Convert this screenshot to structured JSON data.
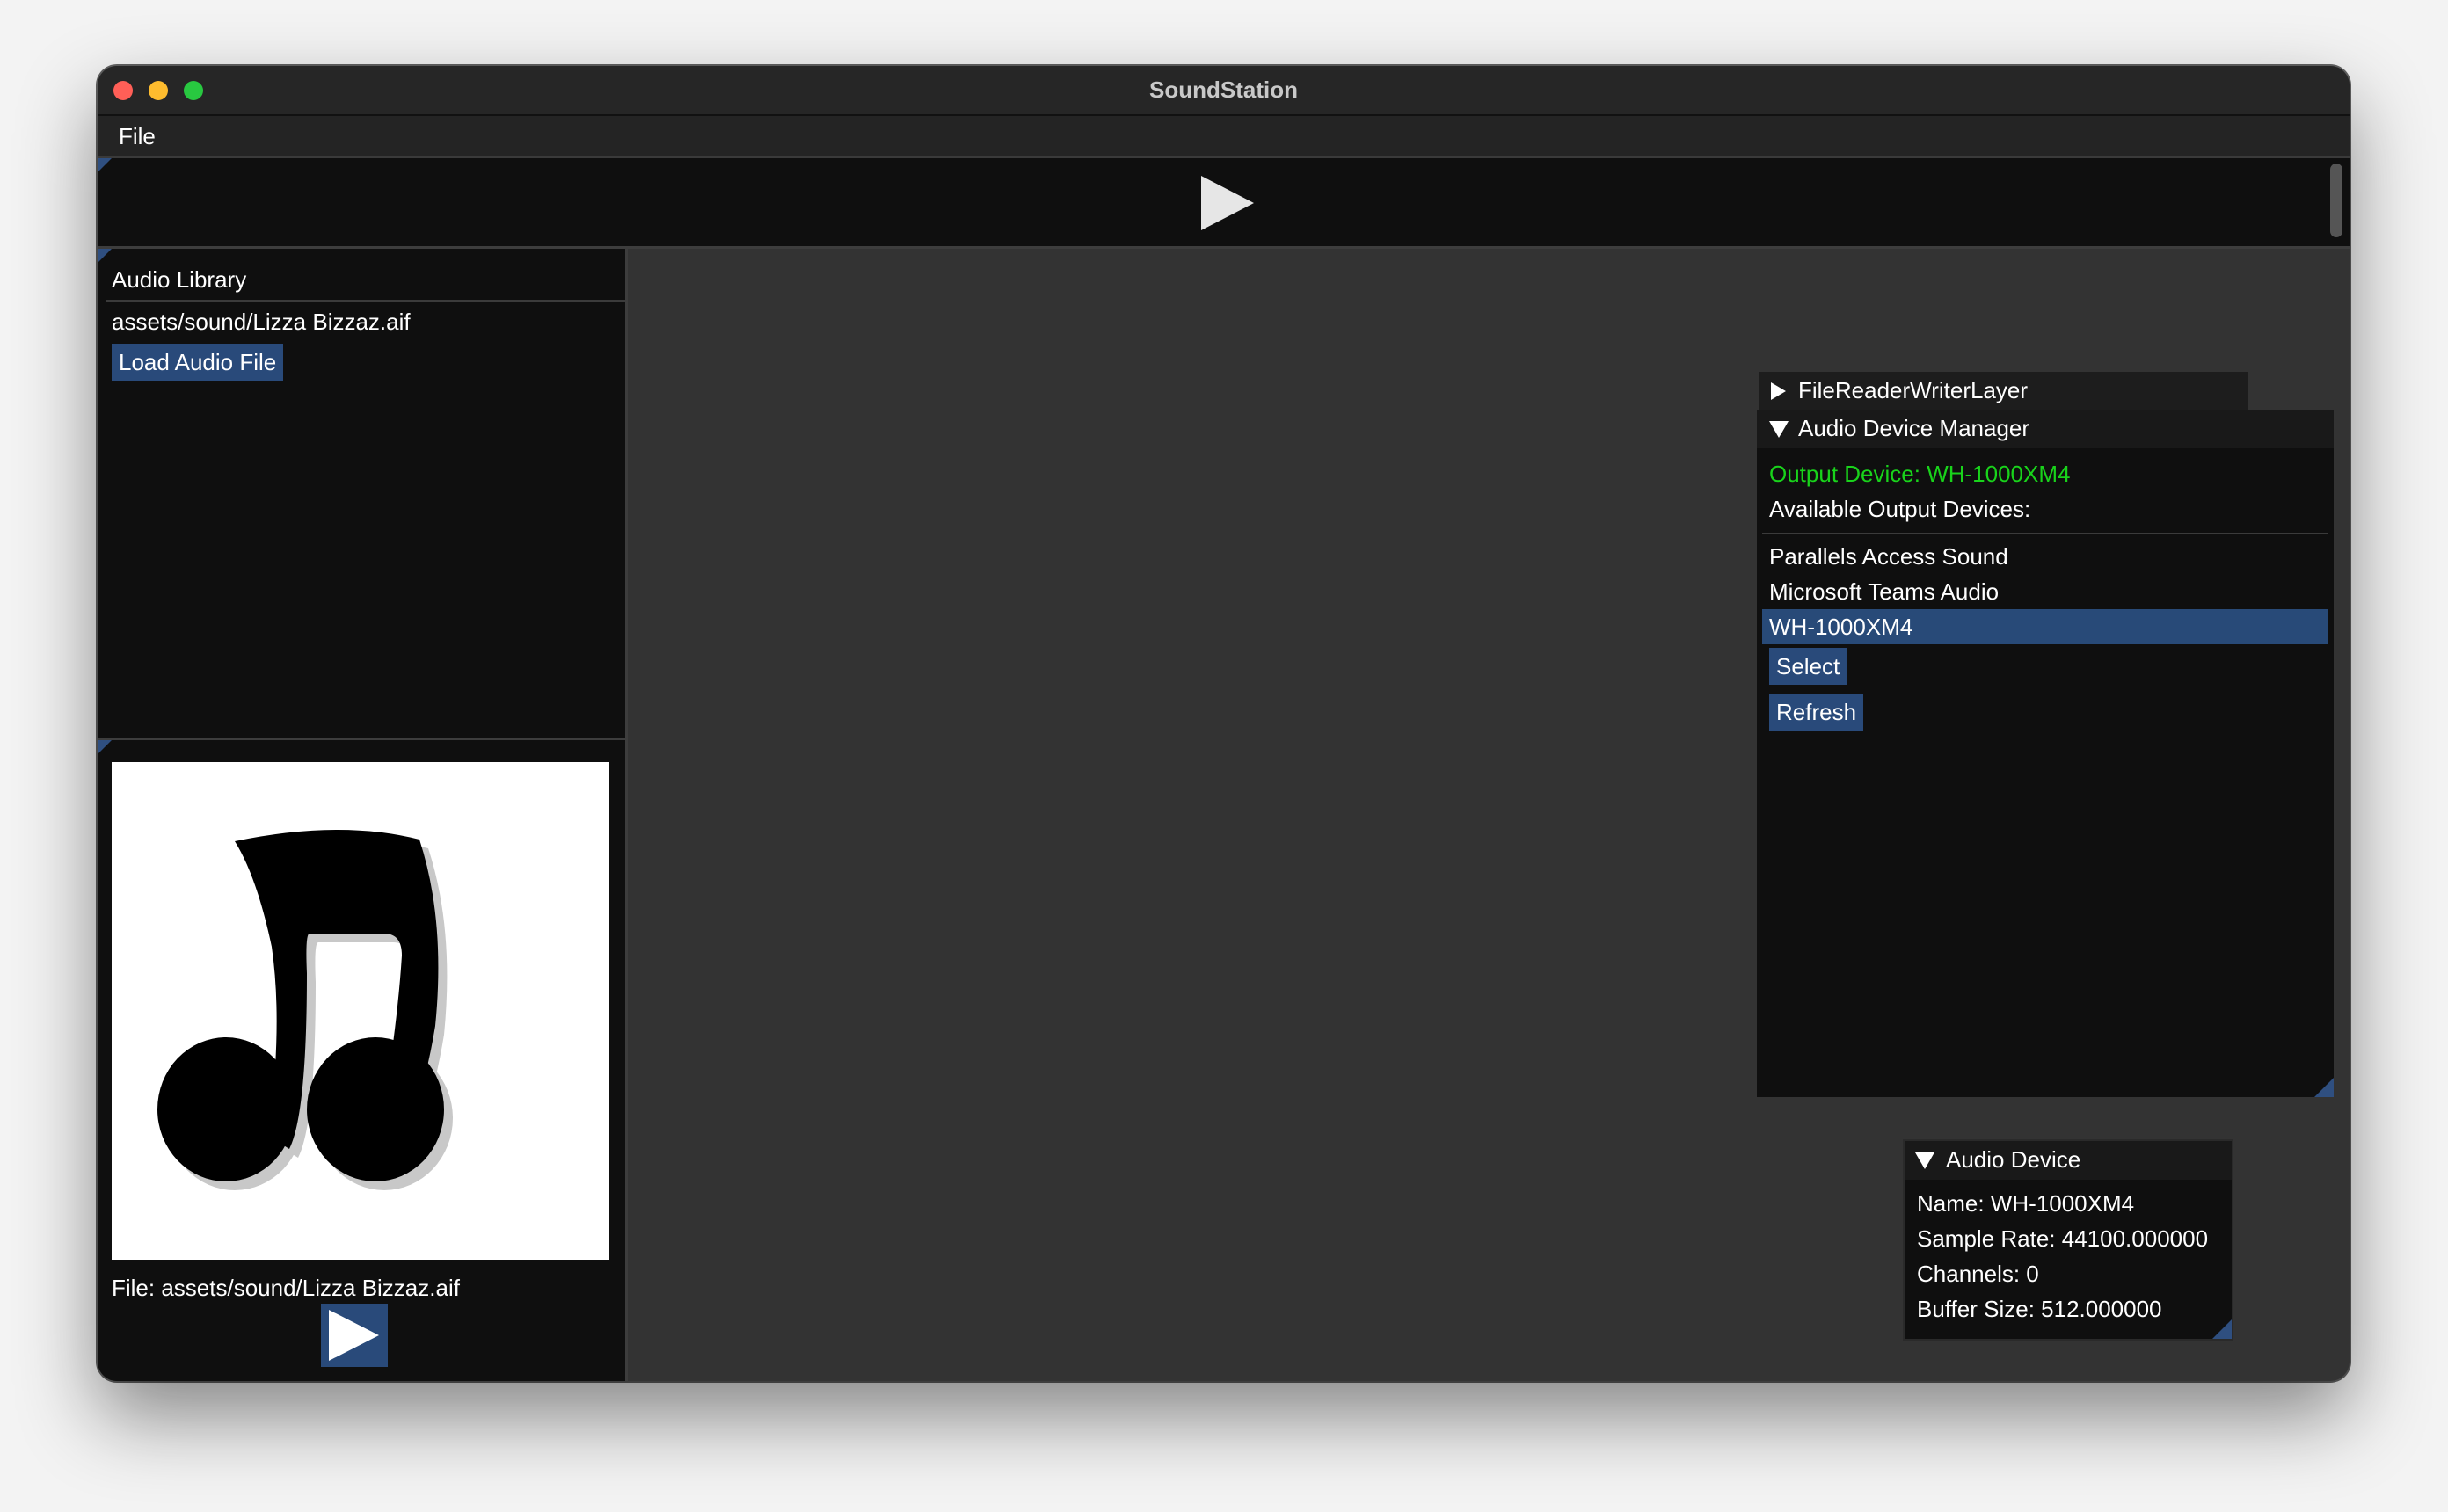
{
  "window": {
    "title": "SoundStation"
  },
  "menu": {
    "file": "File"
  },
  "library": {
    "title": "Audio Library",
    "items": [
      "assets/sound/Lizza Bizzaz.aif"
    ],
    "load_button": "Load Audio File"
  },
  "player": {
    "file_label": "File: assets/sound/Lizza Bizzaz.aif"
  },
  "file_reader": {
    "title": "FileReaderWriterLayer"
  },
  "device_manager": {
    "title": "Audio Device Manager",
    "output_device": "Output Device: WH-1000XM4",
    "available_label": "Available Output Devices:",
    "devices": [
      "Parallels Access Sound",
      "Microsoft Teams Audio",
      "WH-1000XM4"
    ],
    "selected_device": "WH-1000XM4",
    "select_button": "Select",
    "refresh_button": "Refresh"
  },
  "audio_device": {
    "title": "Audio Device",
    "name": "Name: WH-1000XM4",
    "sample_rate": "Sample Rate: 44100.000000",
    "channels": "Channels: 0",
    "buffer_size": "Buffer Size: 512.000000"
  },
  "colors": {
    "accent": "#294a7a",
    "output_green": "#19d31b",
    "panel_bg": "#0f0f0f",
    "workspace_bg": "#333333"
  }
}
